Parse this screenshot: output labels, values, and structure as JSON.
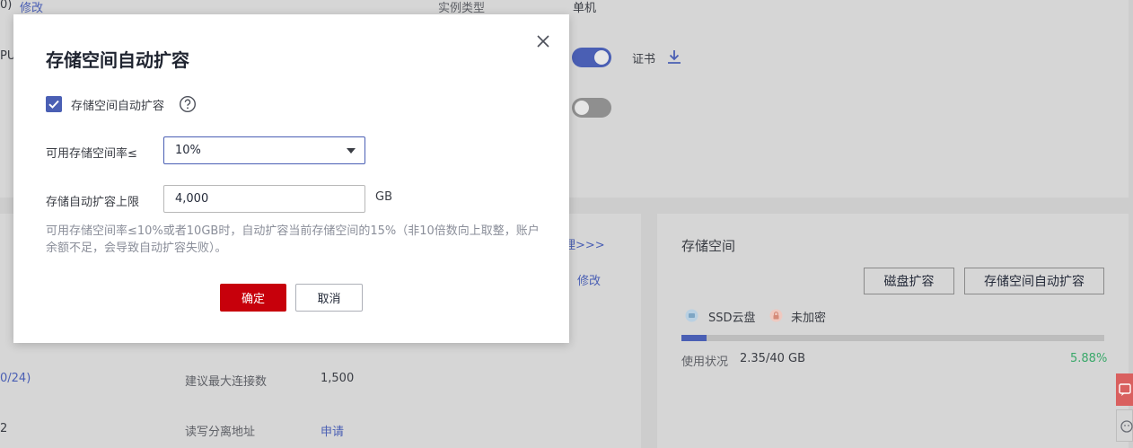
{
  "background": {
    "top_left_fragment": "0)",
    "top_modify_link": "修改",
    "instance_type_label": "实例类型",
    "instance_type_value": "单机",
    "cpu_fragment": "PU",
    "cert_label": "证书",
    "manage_link_fragment": "理>>>",
    "modify_link": "修改",
    "row1_left_fragment": "0/24)",
    "max_conn_label": "建议最大连接数",
    "max_conn_value": "1,500",
    "row2_left_fragment": "2",
    "rw_split_label": "读写分离地址",
    "rw_split_link": "申请"
  },
  "storage_panel": {
    "title": "存储空间",
    "disk_expand_button": "磁盘扩容",
    "auto_expand_button": "存储空间自动扩容",
    "ssd_label": "SSD云盘",
    "encrypt_label": "未加密",
    "usage_label": "使用状况",
    "usage_value": "2.35/40 GB",
    "usage_percent": "5.88%",
    "usage_fraction": 0.0588
  },
  "dialog": {
    "title": "存储空间自动扩容",
    "enable_checkbox_label": "存储空间自动扩容",
    "enable_checked": true,
    "threshold_label": "可用存储空间率≤",
    "threshold_value": "10%",
    "limit_label": "存储自动扩容上限",
    "limit_value": "4,000",
    "limit_unit": "GB",
    "hint": "可用存储空间率≤10%或者10GB时，自动扩容当前存储空间的15%（非10倍数向上取整，账户余额不足，会导致自动扩容失败）。",
    "ok_button": "确定",
    "cancel_button": "取消"
  },
  "colors": {
    "accent": "#4a5fb4",
    "primary_button": "#c7000b",
    "success_text": "#3aa86a",
    "float_button": "#d9605f"
  }
}
